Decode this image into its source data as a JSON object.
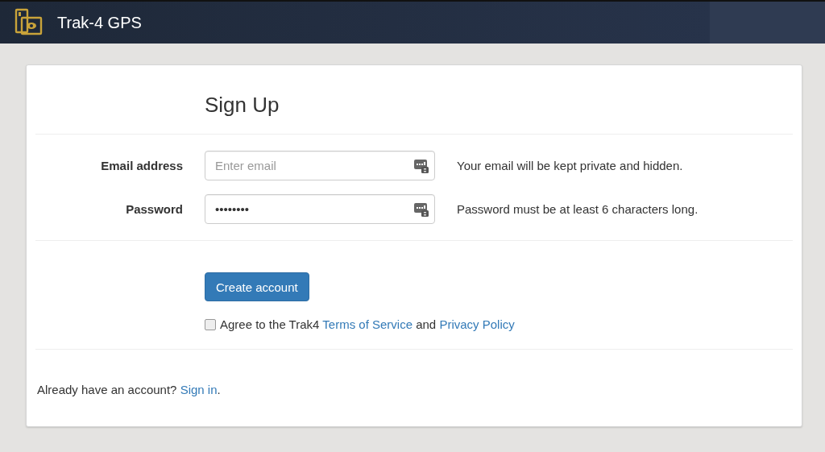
{
  "header": {
    "title": "Trak-4 GPS"
  },
  "form": {
    "title": "Sign Up",
    "fields": [
      {
        "label": "Email address",
        "placeholder": "Enter email",
        "help": "Your email will be kept private and hidden."
      },
      {
        "label": "Password",
        "value": "••••••••",
        "help": "Password must be at least 6 characters long."
      }
    ],
    "submit": "Create account",
    "agree": {
      "checked": false,
      "text": "Agree to the Trak4",
      "terms_link": "Terms of Service",
      "joiner": "and",
      "privacy_link": "Privacy Policy"
    }
  },
  "footer": {
    "text": "Already have an account?",
    "link": "Sign in",
    "end": "."
  }
}
